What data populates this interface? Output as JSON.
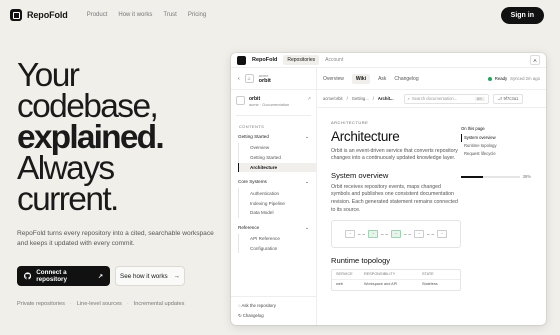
{
  "nav": {
    "brand": "RepoFold",
    "links": [
      "Product",
      "How it works",
      "Trust",
      "Pricing"
    ],
    "signin": "Sign in"
  },
  "hero": {
    "line1": "Your",
    "line2": "codebase,",
    "line3": "explained.",
    "line4": "Always",
    "line5": "current.",
    "subtitle": "RepoFold turns every repository into a cited, searchable workspace and keeps it updated with every commit.",
    "cta_primary": "Connect a repository",
    "cta_secondary": "See how it works",
    "features": [
      "Private repositories",
      "Line-level sources",
      "Incremental updates"
    ]
  },
  "app": {
    "brand": "RepoFold",
    "top_tabs": [
      "Repositories",
      "Account"
    ],
    "avatar": "A",
    "repo_org": "acme",
    "repo_name": "orbit",
    "tabs": [
      "Overview",
      "Wiki",
      "Ask",
      "Changelog"
    ],
    "status": "Ready",
    "synced": "Synced 2m ago",
    "sidebar": {
      "repo_name": "orbit",
      "repo_sub": "acme · Documentation",
      "contents_label": "CONTENTS",
      "groups": [
        {
          "title": "Getting Started",
          "items": [
            "Overview",
            "Getting Started",
            "Architecture"
          ]
        },
        {
          "title": "Core Systems",
          "items": [
            "Authentication",
            "Indexing Pipeline",
            "Data Model"
          ]
        },
        {
          "title": "Reference",
          "items": [
            "API Reference",
            "Configuration"
          ]
        }
      ],
      "active_item": "Architecture",
      "footer": [
        "Ask the repository",
        "Changelog"
      ]
    },
    "crumbs": [
      "acme/orbit",
      "Getting...",
      "Archit..."
    ],
    "search_placeholder": "Search documentation...",
    "search_kbd": "⌘K",
    "btn_label": "⎇ 9f7c3a1",
    "doc": {
      "eyebrow": "ARCHITECTURE",
      "title": "Architecture",
      "intro": "Orbit is an event-driven service that converts repository changes into a continuously updated knowledge layer.",
      "h2_1": "System overview",
      "p1": "Orbit receives repository events, maps changed symbols and publishes one consistent documentation revision. Each generated statement remains connected to its source.",
      "nodes": [
        "→",
        "→",
        "→",
        "→",
        "→"
      ],
      "h2_2": "Runtime topology",
      "table_head": [
        "SERVICE",
        "RESPONSIBILITY",
        "STATE"
      ],
      "table_row": [
        "web",
        "Workspace and API",
        "Stateless"
      ]
    },
    "toc": {
      "title": "On this page",
      "items": [
        "System overview",
        "Runtime topology",
        "Request lifecycle"
      ],
      "progress_label": "38%",
      "progress": 0.38
    }
  }
}
